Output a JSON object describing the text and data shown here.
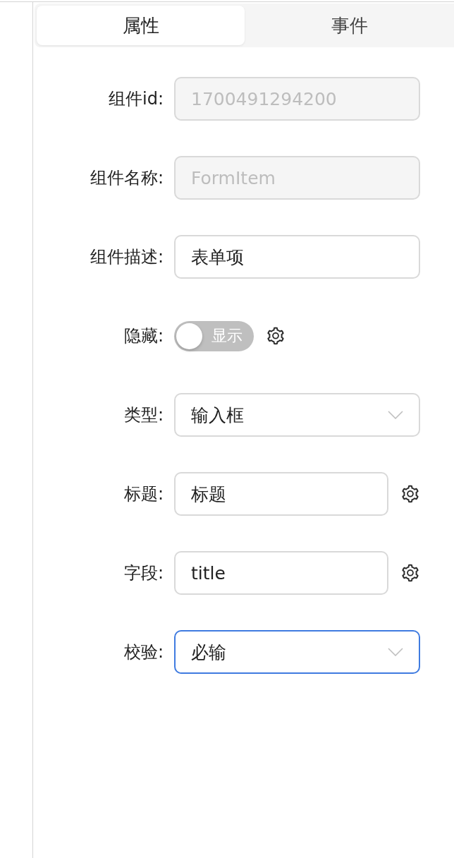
{
  "tabs": [
    {
      "label": "属性",
      "selected": true
    },
    {
      "label": "事件",
      "selected": false
    }
  ],
  "fields": [
    {
      "label": "组件id:",
      "kind": "input",
      "value": "1700491294200",
      "disabled": true,
      "focused": false,
      "has_settings": false
    },
    {
      "label": "组件名称:",
      "kind": "input",
      "value": "FormItem",
      "disabled": true,
      "focused": false,
      "has_settings": false
    },
    {
      "label": "组件描述:",
      "kind": "input",
      "value": "表单项",
      "disabled": false,
      "focused": false,
      "has_settings": false
    },
    {
      "label": "隐藏:",
      "kind": "switch",
      "text": "显示",
      "on": false,
      "has_settings": true
    },
    {
      "label": "类型:",
      "kind": "select",
      "value": "输入框",
      "focused": false,
      "has_settings": false
    },
    {
      "label": "标题:",
      "kind": "input",
      "value": "标题",
      "disabled": false,
      "focused": false,
      "has_settings": true
    },
    {
      "label": "字段:",
      "kind": "input",
      "value": "title",
      "disabled": false,
      "focused": false,
      "has_settings": true
    },
    {
      "label": "校验:",
      "kind": "select",
      "value": "必输",
      "focused": true,
      "has_settings": false
    }
  ]
}
